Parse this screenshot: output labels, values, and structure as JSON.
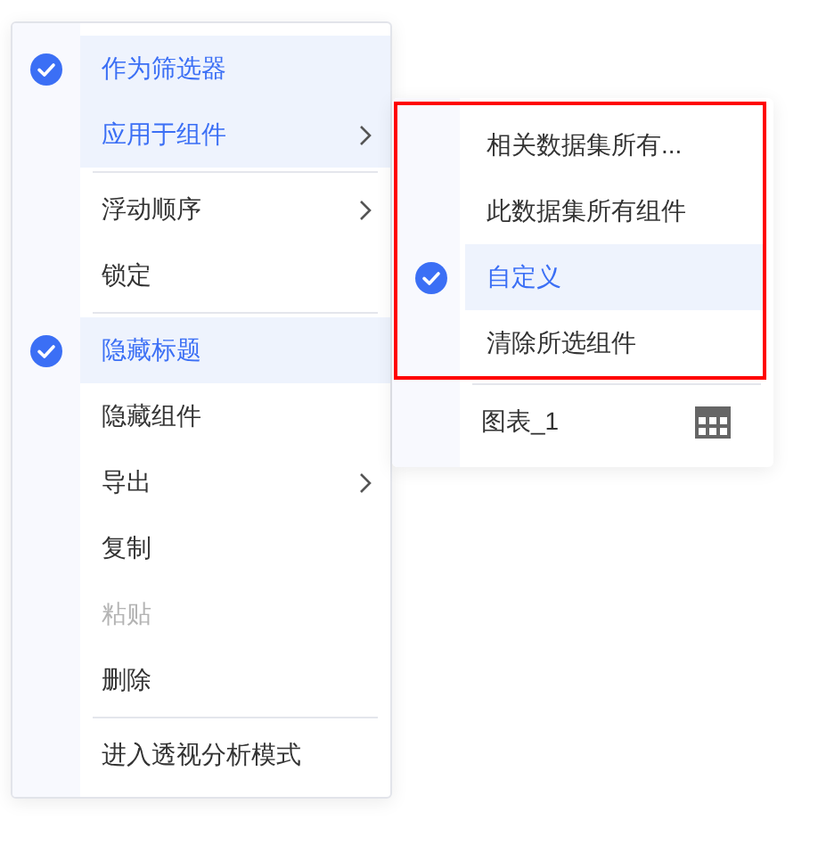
{
  "menu": {
    "groups": [
      [
        {
          "label": "作为筛选器",
          "checked": true,
          "selected": true,
          "has_submenu": false,
          "disabled": false
        },
        {
          "label": "应用于组件",
          "checked": false,
          "selected": true,
          "has_submenu": true,
          "disabled": false
        }
      ],
      [
        {
          "label": "浮动顺序",
          "checked": false,
          "selected": false,
          "has_submenu": true,
          "disabled": false
        },
        {
          "label": "锁定",
          "checked": false,
          "selected": false,
          "has_submenu": false,
          "disabled": false
        }
      ],
      [
        {
          "label": "隐藏标题",
          "checked": true,
          "selected": true,
          "has_submenu": false,
          "disabled": false
        },
        {
          "label": "隐藏组件",
          "checked": false,
          "selected": false,
          "has_submenu": false,
          "disabled": false
        },
        {
          "label": "导出",
          "checked": false,
          "selected": false,
          "has_submenu": true,
          "disabled": false
        },
        {
          "label": "复制",
          "checked": false,
          "selected": false,
          "has_submenu": false,
          "disabled": false
        },
        {
          "label": "粘贴",
          "checked": false,
          "selected": false,
          "has_submenu": false,
          "disabled": true
        },
        {
          "label": "删除",
          "checked": false,
          "selected": false,
          "has_submenu": false,
          "disabled": false
        }
      ],
      [
        {
          "label": "进入透视分析模式",
          "checked": false,
          "selected": false,
          "has_submenu": false,
          "disabled": false
        }
      ]
    ]
  },
  "submenu": {
    "highlighted": true,
    "options": [
      {
        "label": "相关数据集所有...",
        "checked": false,
        "selected": false
      },
      {
        "label": "此数据集所有组件",
        "checked": false,
        "selected": false
      },
      {
        "label": "自定义",
        "checked": true,
        "selected": true
      },
      {
        "label": "清除所选组件",
        "checked": false,
        "selected": false
      }
    ],
    "components": [
      {
        "label": "图表_1"
      }
    ]
  }
}
